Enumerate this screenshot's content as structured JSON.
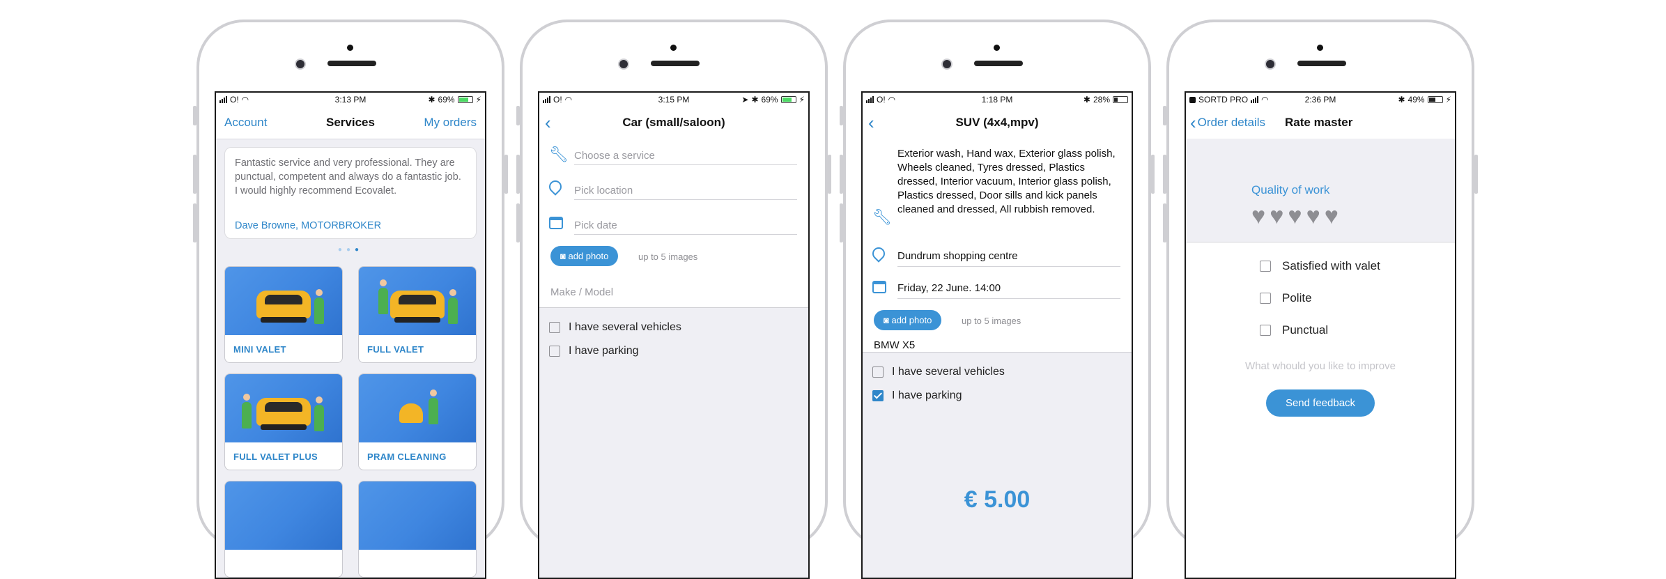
{
  "phones": [
    {
      "status": {
        "carrier": "O!",
        "time": "3:13 PM",
        "battery": "69%"
      },
      "nav": {
        "left": "Account",
        "title": "Services",
        "right": "My orders"
      },
      "testimonial": {
        "text": "Fantastic service and very professional. They are punctual, competent and always do  a  fantastic job. I would highly recommend Ecovalet.",
        "author": "Dave Browne, MOTORBROKER"
      },
      "cards": [
        "MINI VALET",
        "FULL VALET",
        "FULL VALET PLUS",
        "PRAM CLEANING"
      ]
    },
    {
      "status": {
        "carrier": "O!",
        "time": "3:15 PM",
        "battery": "69%"
      },
      "nav": {
        "title": "Car (small/saloon)"
      },
      "fields": {
        "service_placeholder": "Choose a service",
        "location_placeholder": "Pick location",
        "date_placeholder": "Pick date",
        "add_photo": "add photo",
        "photo_hint": "up to 5 images",
        "make_placeholder": "Make / Model"
      },
      "options": [
        {
          "label": "I have several vehicles",
          "checked": false
        },
        {
          "label": "I have parking",
          "checked": false
        }
      ]
    },
    {
      "status": {
        "carrier": "O!",
        "time": "1:18 PM",
        "battery": "28%"
      },
      "nav": {
        "title": "SUV (4x4,mpv)"
      },
      "service_text": "Exterior wash, Hand wax, Exterior glass polish, Wheels cleaned, Tyres dressed, Plastics dressed, Interior vacuum, Interior glass polish, Plastics dressed, Door sills and kick panels cleaned and dressed, All rubbish removed.",
      "location": "Dundrum shopping centre",
      "date": "Friday, 22 June. 14:00",
      "add_photo": "add photo",
      "photo_hint": "up to 5 images",
      "vehicle": "BMW X5",
      "options": [
        {
          "label": "I have several vehicles",
          "checked": false
        },
        {
          "label": "I have parking",
          "checked": true
        }
      ],
      "price": "€ 5.00"
    },
    {
      "status": {
        "carrier": "SORTD PRO",
        "time": "2:36 PM",
        "battery": "49%"
      },
      "nav": {
        "back": "Order details",
        "title": "Rate master"
      },
      "rating_label": "Quality of work",
      "rating_value": 0,
      "rating_max": 5,
      "options": [
        {
          "label": "Satisfied with valet",
          "checked": false
        },
        {
          "label": "Polite",
          "checked": false
        },
        {
          "label": "Punctual",
          "checked": false
        }
      ],
      "improve_placeholder": "What whould you like to improve",
      "send_button": "Send feedback"
    }
  ],
  "colors": {
    "accent": "#2e86c9",
    "button": "#3b93d6",
    "battery": "#4cd964"
  }
}
